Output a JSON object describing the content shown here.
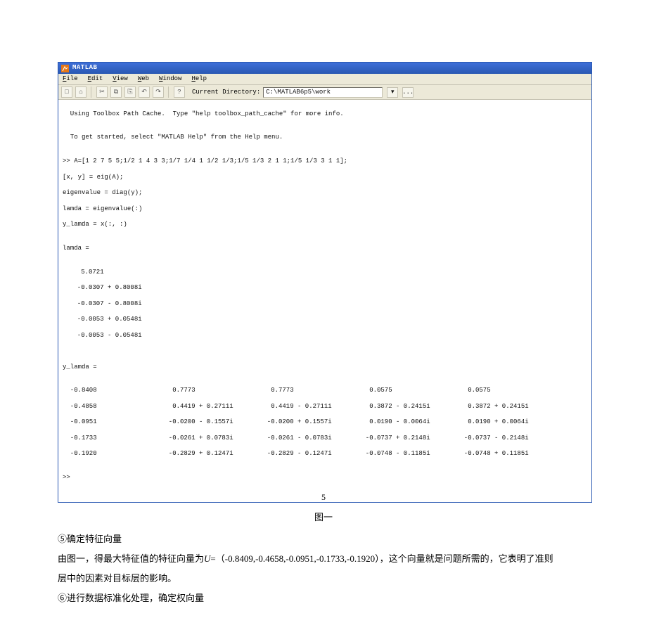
{
  "matlab": {
    "title": "MATLAB",
    "menu": {
      "file": "File",
      "edit": "Edit",
      "view": "View",
      "web": "Web",
      "window": "Window",
      "help": "Help"
    },
    "toolbar": {
      "current_dir_label": "Current Directory:",
      "current_dir_value": "C:\\MATLAB6p5\\work",
      "go_glyph": "▾",
      "browse_glyph": "...",
      "icons": {
        "new": "□",
        "open": "⌂",
        "cut": "✂",
        "copy": "⧉",
        "paste": "⎘",
        "undo": "↶",
        "redo": "↷",
        "help": "?"
      }
    },
    "console": {
      "line1": "  Using Toolbox Path Cache.  Type \"help toolbox_path_cache\" for more info.",
      "blank": "",
      "line2": "  To get started, select \"MATLAB Help\" from the Help menu.",
      "cmd1": ">> A=[1 2 7 5 5;1/2 1 4 3 3;1/7 1/4 1 1/2 1/3;1/5 1/3 2 1 1;1/5 1/3 3 1 1];",
      "cmd2": "[x, y] = eig(A);",
      "cmd3": "eigenvalue = diag(y);",
      "cmd4": "lamda = eigenvalue(:)",
      "cmd5": "y_lamda = x(:, :)",
      "lamda_header": "lamda =",
      "lamda_values": [
        "   5.0721",
        "  -0.0307 + 0.8008i",
        "  -0.0307 - 0.8008i",
        "  -0.0053 + 0.0548i",
        "  -0.0053 - 0.0548i"
      ],
      "ylamda_header": "y_lamda =",
      "ylamda_rows": [
        [
          "  -0.8408",
          "   0.7773          ",
          "   0.7773          ",
          "   0.0575          ",
          "   0.0575          "
        ],
        [
          "  -0.4858",
          "   0.4419 + 0.2711i",
          "   0.4419 - 0.2711i",
          "   0.3872 - 0.2415i",
          "   0.3872 + 0.2415i"
        ],
        [
          "  -0.0951",
          "  -0.0200 - 0.1557i",
          "  -0.0200 + 0.1557i",
          "   0.0190 - 0.0064i",
          "   0.0190 + 0.0064i"
        ],
        [
          "  -0.1733",
          "  -0.0261 + 0.0783i",
          "  -0.0261 - 0.0783i",
          "  -0.0737 + 0.2148i",
          "  -0.0737 - 0.2148i"
        ],
        [
          "  -0.1920",
          "  -0.2829 + 0.1247i",
          "  -0.2829 - 0.1247i",
          "  -0.0748 - 0.1185i",
          "  -0.0748 + 0.1185i"
        ]
      ],
      "prompt_end": ">>"
    }
  },
  "caption": "图一",
  "text": {
    "p1": "⑤确定特征向量",
    "p2a": "由图一，得最大特征值的特征向量为",
    "p2b": "U",
    "p2c": "=（-0.8409,-0.4658,-0.0951,-0.1733,-0.1920），这个向量就是问题所需的，它表明了准则",
    "p3": "层中的因素对目标层的影响。",
    "p4": "⑥进行数据标准化处理，确定权向量"
  },
  "page_number": "5"
}
